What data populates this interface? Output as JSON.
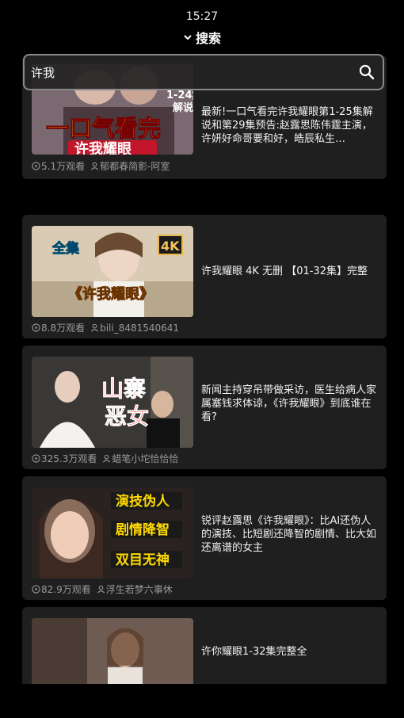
{
  "status_bar": {
    "time": "15:27"
  },
  "header": {
    "title": "搜索",
    "chevron_icon": "chevron-down-icon"
  },
  "search": {
    "value": "许我",
    "icon": "search-icon"
  },
  "colors": {
    "background": "#000000",
    "card": "#1f1f1f",
    "meta_text": "#9a9a9a",
    "search_border": "#8a8a8a"
  },
  "videos": [
    {
      "title": "最新!一口气看完许我耀眼第1-25集解说和第29集预告:赵露思陈伟霆主演，许妍好命哥要和好，皓辰私生…",
      "views": "5.1万观看",
      "author": "郁都春简影-阿室",
      "thumb_text": [
        "1-24集",
        "解说",
        "一口气看完",
        "许我耀眼"
      ]
    },
    {
      "title": "许我耀眼 4K 无删 【01-32集】完整",
      "views": "8.8万观看",
      "author": "bili_8481540641",
      "thumb_text": [
        "全集",
        "4K",
        "《许我耀眼》"
      ]
    },
    {
      "title": "新闻主持穿吊带做采访，医生给病人家属塞钱求体谅，《许我耀眼》到底谁在看?",
      "views": "325.3万观看",
      "author": "蜡笔小坨恰恰恰",
      "thumb_text": [
        "山寨",
        "恶女"
      ]
    },
    {
      "title": "锐评赵露思《许我耀眼》：比AI还伪人的演技、比短剧还降智的剧情、比大如还离谱的女主",
      "views": "82.9万观看",
      "author": "浮生若梦六事休",
      "thumb_text": [
        "演技伪人",
        "剧情降智",
        "双目无神"
      ]
    },
    {
      "title": "许你耀眼1-32集完整全",
      "views": "",
      "author": "",
      "thumb_text": []
    }
  ]
}
